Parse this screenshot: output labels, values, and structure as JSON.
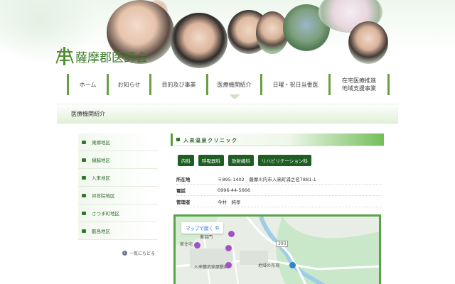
{
  "site": {
    "logo_text": "薩摩郡医師会"
  },
  "nav": [
    {
      "label": "ホーム",
      "active": false
    },
    {
      "label": "お知らせ",
      "active": false
    },
    {
      "label": "目的及び事業",
      "active": false
    },
    {
      "label": "医療機関紹介",
      "active": true
    },
    {
      "label": "日曜・祝日当番医",
      "active": false
    },
    {
      "label_line1": "在宅医療推進",
      "label_line2": "地域支援事業",
      "active": false
    }
  ],
  "page_title": "医療機関紹介",
  "sidebar": {
    "items": [
      {
        "label": "東郷地区"
      },
      {
        "label": "樋脇地区"
      },
      {
        "label": "入来地区"
      },
      {
        "label": "祁答院地区"
      },
      {
        "label": "さつま町地区"
      },
      {
        "label": "甑島地区"
      }
    ],
    "back_label": "一覧にもどる"
  },
  "clinic": {
    "name": "入来温泉クリニック",
    "departments": [
      "内科",
      "呼吸器科",
      "放射線科",
      "リハビリテーション科"
    ],
    "details": [
      {
        "key": "所在地",
        "value": "〒895-1402　薩摩川内市入来町浦之名7881-1"
      },
      {
        "key": "電話",
        "value": "0996-44-5666"
      },
      {
        "key": "管理者",
        "value": "今村　純孝"
      }
    ]
  },
  "map": {
    "open_label": "マップで開く",
    "labels": {
      "clinic_name": "入来温泉クリニック",
      "route": "393",
      "area_a": "家住宅",
      "area_b": "入来麓武家屋敷群",
      "area_c": "地域の売場",
      "area_d": "薬目門"
    }
  },
  "colors": {
    "accent_green": "#2f7a2a",
    "tag_bg": "#1f5e23",
    "map_border": "#5aa24a"
  }
}
